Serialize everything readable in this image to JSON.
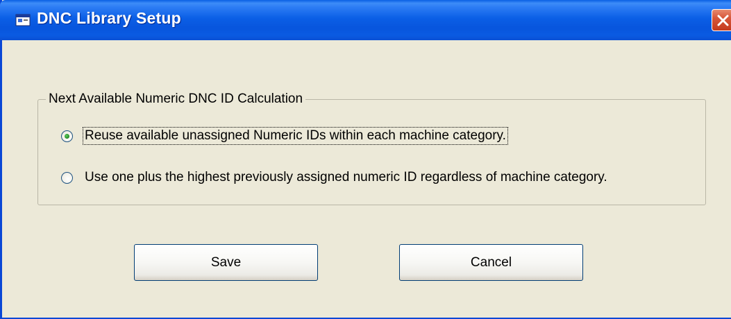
{
  "window": {
    "title": "DNC Library Setup",
    "icon": "application-window-icon",
    "close": "close-icon"
  },
  "group": {
    "legend": "Next Available Numeric DNC ID Calculation",
    "options": [
      {
        "label": "Reuse available unassigned Numeric IDs within each machine category.",
        "checked": true
      },
      {
        "label": "Use one plus the highest previously assigned numeric ID regardless of machine category.",
        "checked": false
      }
    ]
  },
  "buttons": {
    "save_label": "Save",
    "cancel_label": "Cancel"
  },
  "colors": {
    "titlebar": "#0a5fe4",
    "dialog_bg": "#ece9d8",
    "close_button": "#d7573a",
    "radio_dot": "#2a8f2a"
  }
}
